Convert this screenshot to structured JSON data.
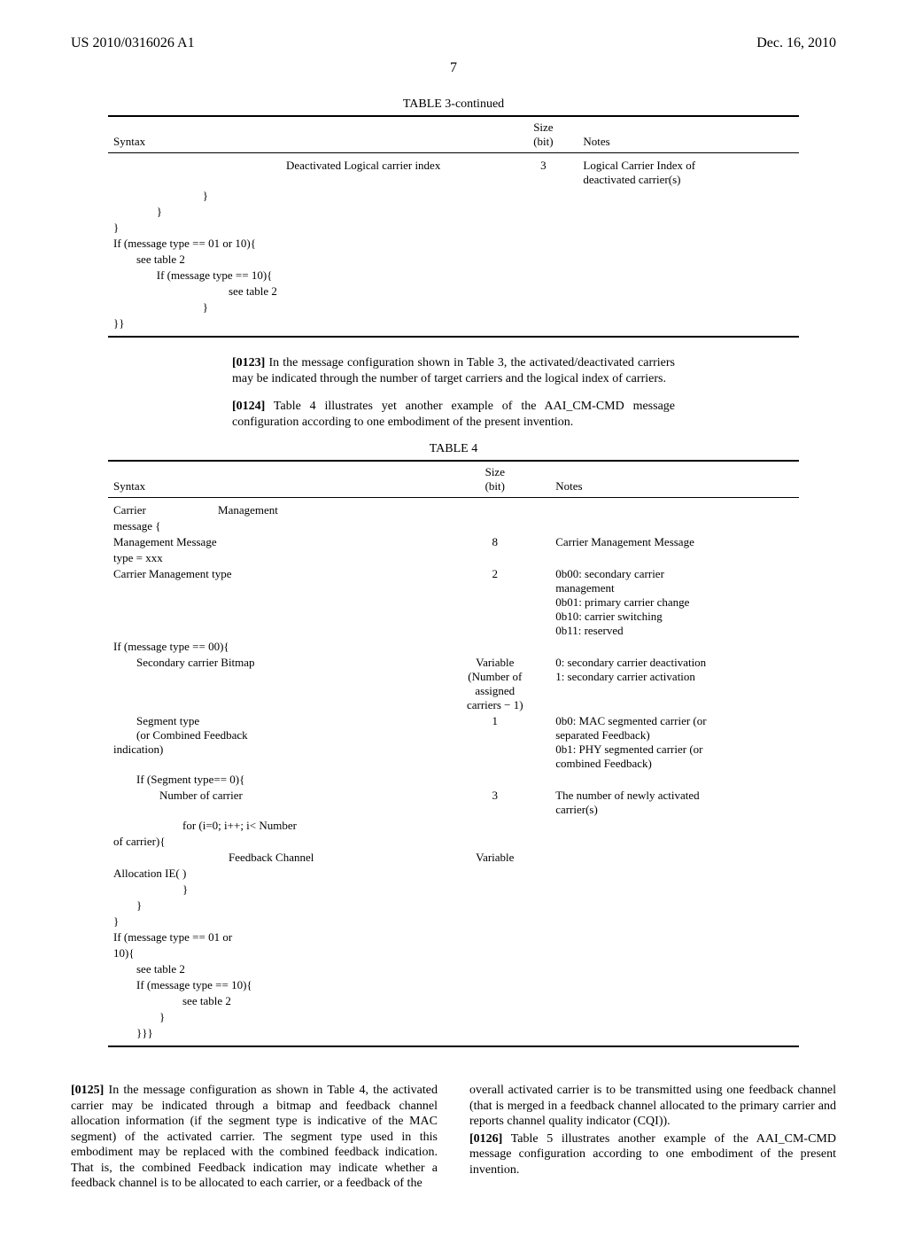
{
  "header": {
    "left": "US 2010/0316026 A1",
    "right": "Dec. 16, 2010"
  },
  "page_number": "7",
  "table3": {
    "caption": "TABLE 3-continued",
    "head": {
      "syntax": "Syntax",
      "size": "Size\n(bit)",
      "notes": "Notes"
    },
    "rows": [
      {
        "syntax": "                                                            Deactivated Logical carrier index",
        "size": "3",
        "notes": "Logical Carrier Index of\ndeactivated carrier(s)"
      },
      {
        "syntax": "                               }",
        "size": "",
        "notes": ""
      },
      {
        "syntax": "               }",
        "size": "",
        "notes": ""
      },
      {
        "syntax": "}",
        "size": "",
        "notes": ""
      },
      {
        "syntax": "If (message type == 01 or 10){",
        "size": "",
        "notes": ""
      },
      {
        "syntax": "        see table 2",
        "size": "",
        "notes": ""
      },
      {
        "syntax": "               If (message type == 10){",
        "size": "",
        "notes": ""
      },
      {
        "syntax": "                                        see table 2",
        "size": "",
        "notes": ""
      },
      {
        "syntax": "                               }",
        "size": "",
        "notes": ""
      },
      {
        "syntax": "}}",
        "size": "",
        "notes": ""
      }
    ]
  },
  "para_0123": {
    "num": "[0123]",
    "text": "    In the message configuration shown in Table 3, the activated/deactivated carriers may be indicated through the number of target carriers and the logical index of carriers."
  },
  "para_0124": {
    "num": "[0124]",
    "text": "    Table 4 illustrates yet another example of the AAI_CM-CMD message configuration according to one embodiment of the present invention."
  },
  "table4": {
    "caption": "TABLE 4",
    "head": {
      "syntax": "Syntax",
      "size": "Size\n(bit)",
      "notes": "Notes"
    },
    "rows": [
      {
        "syntax": "Carrier                         Management",
        "size": "",
        "notes": ""
      },
      {
        "syntax": "message {",
        "size": "",
        "notes": ""
      },
      {
        "syntax": "Management Message",
        "size": "8",
        "notes": "Carrier Management Message"
      },
      {
        "syntax": "type = xxx",
        "size": "",
        "notes": ""
      },
      {
        "syntax": "Carrier Management type",
        "size": "2",
        "notes": "0b00: secondary carrier\nmanagement\n0b01: primary carrier change\n0b10: carrier switching\n0b11: reserved"
      },
      {
        "syntax": "If (message type == 00){",
        "size": "",
        "notes": ""
      },
      {
        "syntax": "        Secondary carrier Bitmap",
        "size": "Variable\n(Number of\nassigned\ncarriers − 1)",
        "notes": "0: secondary carrier deactivation\n1: secondary carrier activation"
      },
      {
        "syntax": "        Segment type\n        (or Combined Feedback\nindication)",
        "size": "1",
        "notes": "0b0: MAC segmented carrier (or\nseparated Feedback)\n0b1: PHY segmented carrier (or\ncombined Feedback)"
      },
      {
        "syntax": "        If (Segment type== 0){",
        "size": "",
        "notes": ""
      },
      {
        "syntax": "                Number of carrier",
        "size": "3",
        "notes": "The number of newly activated\ncarrier(s)"
      },
      {
        "syntax": "                        for (i=0; i++; i< Number",
        "size": "",
        "notes": ""
      },
      {
        "syntax": "of carrier){",
        "size": "",
        "notes": ""
      },
      {
        "syntax": "                                        Feedback Channel",
        "size": "Variable",
        "notes": ""
      },
      {
        "syntax": "Allocation IE( )",
        "size": "",
        "notes": ""
      },
      {
        "syntax": "                        }",
        "size": "",
        "notes": ""
      },
      {
        "syntax": "        }",
        "size": "",
        "notes": ""
      },
      {
        "syntax": "}",
        "size": "",
        "notes": ""
      },
      {
        "syntax": "If (message type == 01 or",
        "size": "",
        "notes": ""
      },
      {
        "syntax": "10){",
        "size": "",
        "notes": ""
      },
      {
        "syntax": "        see table 2",
        "size": "",
        "notes": ""
      },
      {
        "syntax": "        If (message type == 10){",
        "size": "",
        "notes": ""
      },
      {
        "syntax": "                        see table 2",
        "size": "",
        "notes": ""
      },
      {
        "syntax": "                }",
        "size": "",
        "notes": ""
      },
      {
        "syntax": "        }}}",
        "size": "",
        "notes": ""
      }
    ]
  },
  "para_0125": {
    "num": "[0125]",
    "text": "    In the message configuration as shown in Table 4, the activated carrier may be indicated through a bitmap and feedback channel allocation information (if the segment type is indicative of the MAC segment) of the activated carrier. The segment type used in this embodiment may be replaced with the combined feedback indication. That is, the combined Feedback indication may indicate whether a feedback channel is to be allocated to each carrier, or a feedback of the"
  },
  "para_0125b": "overall activated carrier is to be transmitted using one feedback channel (that is merged in a feedback channel allocated to the primary carrier and reports channel quality indicator (CQI)).",
  "para_0126": {
    "num": "[0126]",
    "text": "    Table 5 illustrates another example of the AAI_CM-CMD message configuration according to one embodiment of the present invention."
  }
}
